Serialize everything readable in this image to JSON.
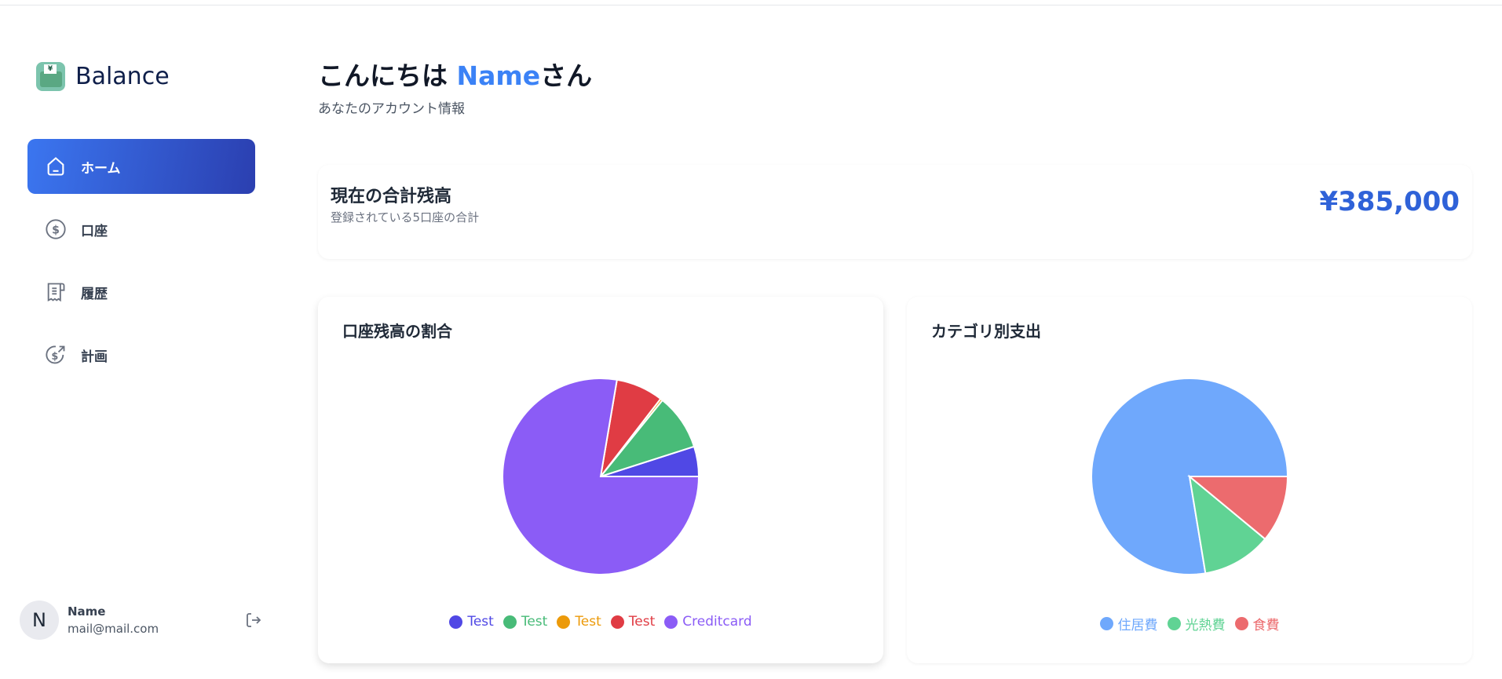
{
  "app": {
    "name": "Balance",
    "logo_icon": "wallet-yen-icon"
  },
  "nav": [
    {
      "label": "ホーム",
      "icon": "home-icon",
      "active": true
    },
    {
      "label": "口座",
      "icon": "dollar-circle-icon"
    },
    {
      "label": "履歴",
      "icon": "receipt-icon"
    },
    {
      "label": "計画",
      "icon": "dollar-growth-icon"
    }
  ],
  "user": {
    "initial": "N",
    "name": "Name",
    "email": "mail@mail.com"
  },
  "header": {
    "greeting": "こんにちは ",
    "name": "Name",
    "suffix": "さん",
    "subtitle": "あなたのアカウント情報"
  },
  "total": {
    "title": "現在の合計残高",
    "subtitle": "登録されている5口座の合計",
    "amount": "¥385,000",
    "accent": "#2f62d8"
  },
  "chart_data": [
    {
      "type": "pie",
      "title": "口座残高の割合",
      "legend": "bottom",
      "start": "3-o'clock",
      "direction": "counter-clockwise",
      "labels": [
        "Test",
        "Test",
        "Test",
        "Test",
        "Creditcard"
      ],
      "values": [
        19000,
        35500,
        1500,
        30000,
        299000
      ],
      "colors": [
        "#5048e5",
        "#48bb78",
        "#ec9a0a",
        "#e03c44",
        "#8b5cf6"
      ]
    },
    {
      "type": "pie",
      "title": "カテゴリ別支出",
      "legend": "bottom",
      "start": "3-o'clock",
      "direction": "counter-clockwise",
      "labels": [
        "住居費",
        "光熱費",
        "食費"
      ],
      "values": [
        77.6,
        11.4,
        11.0
      ],
      "colors": [
        "#6fa8fc",
        "#60d394",
        "#ec6b6e"
      ]
    }
  ]
}
